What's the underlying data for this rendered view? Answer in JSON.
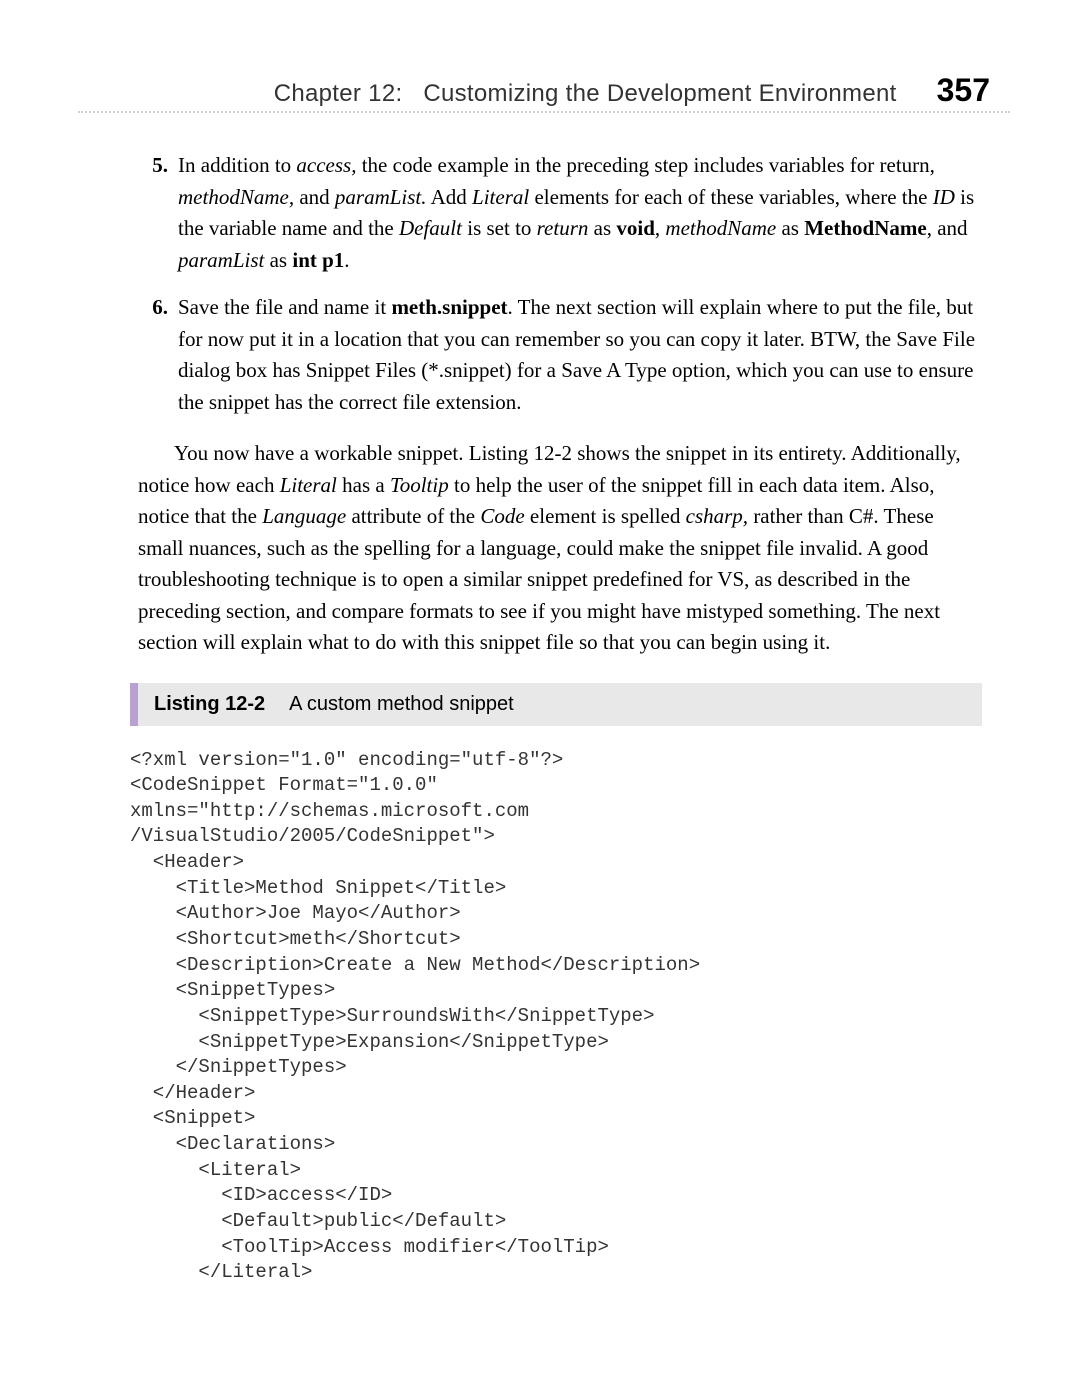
{
  "header": {
    "chapter": "Chapter 12:",
    "title": "Customizing the Development Environment",
    "page_number": "357"
  },
  "list_items": [
    {
      "marker": "5.",
      "segments": [
        {
          "text": "In addition to ",
          "style": ""
        },
        {
          "text": "access,",
          "style": "italic"
        },
        {
          "text": " the code example in the preceding step includes variables for return, ",
          "style": ""
        },
        {
          "text": "methodName,",
          "style": "italic"
        },
        {
          "text": " and ",
          "style": ""
        },
        {
          "text": "paramList.",
          "style": "italic"
        },
        {
          "text": " Add ",
          "style": ""
        },
        {
          "text": "Literal",
          "style": "italic"
        },
        {
          "text": " elements for each of these variables, where the ",
          "style": ""
        },
        {
          "text": "ID",
          "style": "italic"
        },
        {
          "text": " is the variable name and the ",
          "style": ""
        },
        {
          "text": "Default",
          "style": "italic"
        },
        {
          "text": " is set to ",
          "style": ""
        },
        {
          "text": "return",
          "style": "italic"
        },
        {
          "text": " as ",
          "style": ""
        },
        {
          "text": "void",
          "style": "bold"
        },
        {
          "text": ", ",
          "style": ""
        },
        {
          "text": "methodName",
          "style": "italic"
        },
        {
          "text": " as ",
          "style": ""
        },
        {
          "text": "MethodName",
          "style": "bold"
        },
        {
          "text": ", and ",
          "style": ""
        },
        {
          "text": "paramList",
          "style": "italic"
        },
        {
          "text": " as ",
          "style": ""
        },
        {
          "text": "int p1",
          "style": "bold"
        },
        {
          "text": ".",
          "style": ""
        }
      ]
    },
    {
      "marker": "6.",
      "segments": [
        {
          "text": "Save the file and name it ",
          "style": ""
        },
        {
          "text": "meth.snippet",
          "style": "bold"
        },
        {
          "text": ". The next section will explain where to put the file, but for now put it in a location that you can remember so you can copy it later. BTW, the Save File dialog box has Snippet Files (*.snippet) for a Save A Type option, which you can use to ensure the snippet has the correct file extension.",
          "style": ""
        }
      ]
    }
  ],
  "paragraph_segments": [
    {
      "text": "You now have a workable snippet. Listing 12-2 shows the snippet in its entirety. Additionally, notice how each ",
      "style": ""
    },
    {
      "text": "Literal",
      "style": "italic"
    },
    {
      "text": " has a ",
      "style": ""
    },
    {
      "text": "Tooltip",
      "style": "italic"
    },
    {
      "text": " to help the user of the snippet fill in each data item. Also, notice that the ",
      "style": ""
    },
    {
      "text": "Language",
      "style": "italic"
    },
    {
      "text": " attribute of the ",
      "style": ""
    },
    {
      "text": "Code",
      "style": "italic"
    },
    {
      "text": " element is spelled ",
      "style": ""
    },
    {
      "text": "csharp,",
      "style": "italic"
    },
    {
      "text": " rather than C#. These small nuances, such as the spelling for a language, could make the snippet file invalid. A good troubleshooting technique is to open a similar snippet predefined for VS, as described in the preceding section, and compare formats to see if you might have mistyped something. The next section will explain what to do with this snippet file so that you can begin using it.",
      "style": ""
    }
  ],
  "listing": {
    "label": "Listing 12-2",
    "title": "A custom method snippet"
  },
  "code": "<?xml version=\"1.0\" encoding=\"utf-8\"?>\n<CodeSnippet Format=\"1.0.0\"\nxmlns=\"http://schemas.microsoft.com\n/VisualStudio/2005/CodeSnippet\">\n  <Header>\n    <Title>Method Snippet</Title>\n    <Author>Joe Mayo</Author>\n    <Shortcut>meth</Shortcut>\n    <Description>Create a New Method</Description>\n    <SnippetTypes>\n      <SnippetType>SurroundsWith</SnippetType>\n      <SnippetType>Expansion</SnippetType>\n    </SnippetTypes>\n  </Header>\n  <Snippet>\n    <Declarations>\n      <Literal>\n        <ID>access</ID>\n        <Default>public</Default>\n        <ToolTip>Access modifier</ToolTip>\n      </Literal>"
}
